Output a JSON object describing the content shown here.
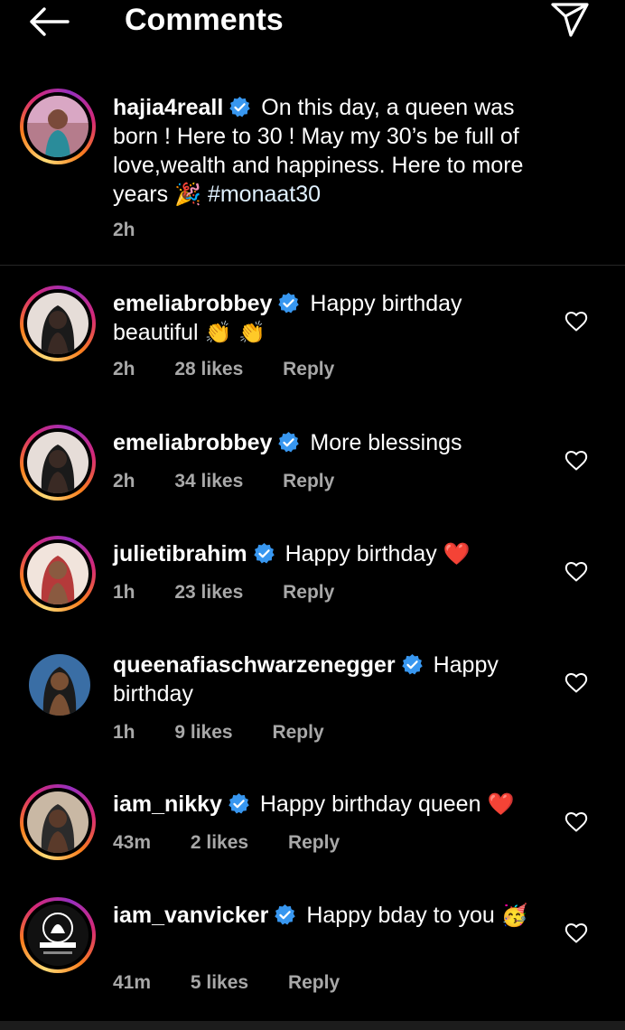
{
  "header": {
    "title": "Comments"
  },
  "caption": {
    "username": "hajia4reall",
    "text": "On this day, a queen was born ! Here to 30 ! May my 30’s be full of love,wealth and happiness. Here to more years",
    "emoji": "🎉",
    "hashtag": "#monaat30",
    "time": "2h"
  },
  "comments": [
    {
      "username": "emeliabrobbey",
      "text": "Happy birthday beautiful",
      "emoji": "👏 👏",
      "time": "2h",
      "likes": "28 likes",
      "reply": "Reply"
    },
    {
      "username": "emeliabrobbey",
      "text": "More blessings",
      "emoji": "",
      "time": "2h",
      "likes": "34 likes",
      "reply": "Reply"
    },
    {
      "username": "julietibrahim",
      "text": "Happy birthday",
      "emoji": "❤️",
      "time": "1h",
      "likes": "23 likes",
      "reply": "Reply"
    },
    {
      "username": "queenafiaschwarzenegger",
      "text": "Happy birthday",
      "emoji": "",
      "time": "1h",
      "likes": "9 likes",
      "reply": "Reply"
    },
    {
      "username": "iam_nikky",
      "text": "Happy birthday queen",
      "emoji": "❤️",
      "time": "43m",
      "likes": "2 likes",
      "reply": "Reply"
    },
    {
      "username": "iam_vanvicker",
      "text": "Happy bday to you",
      "emoji": "🥳",
      "time": "41m",
      "likes": "5 likes",
      "reply": "Reply"
    }
  ],
  "colors": {
    "background": "#000000",
    "verified": "#3897f0",
    "meta": "#a8a8a8",
    "heart_red": "#e0245e"
  },
  "icons": [
    "back-arrow-icon",
    "send-icon",
    "verified-icon",
    "heart-outline-icon"
  ]
}
